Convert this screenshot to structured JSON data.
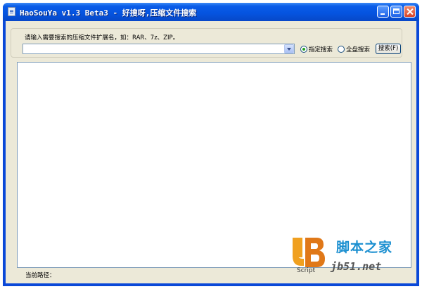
{
  "window": {
    "title": "HaoSouYa v1.3 Beta3 - 好搜呀,压缩文件搜索",
    "icon": "app-icon"
  },
  "search": {
    "prompt_label": "请输入需要搜索的压缩文件扩展名，如：RAR、7z、ZIP。",
    "combo_value": "",
    "radio_specified_label": "指定搜索",
    "radio_specified_checked": true,
    "radio_all_label": "全盘搜索",
    "radio_all_checked": false,
    "search_button_label": "搜索(F)"
  },
  "results": [],
  "statusbar": {
    "current_path_label": "当前路径："
  },
  "watermark": {
    "site_name": "脚本之家",
    "domain": "jb51.net",
    "script_label": "Script"
  },
  "colors": {
    "titlebar": "#0554e0",
    "client_bg": "#ece9d8",
    "watermark_blue": "#1b8fd0",
    "logo_orange": "#f0a020"
  }
}
